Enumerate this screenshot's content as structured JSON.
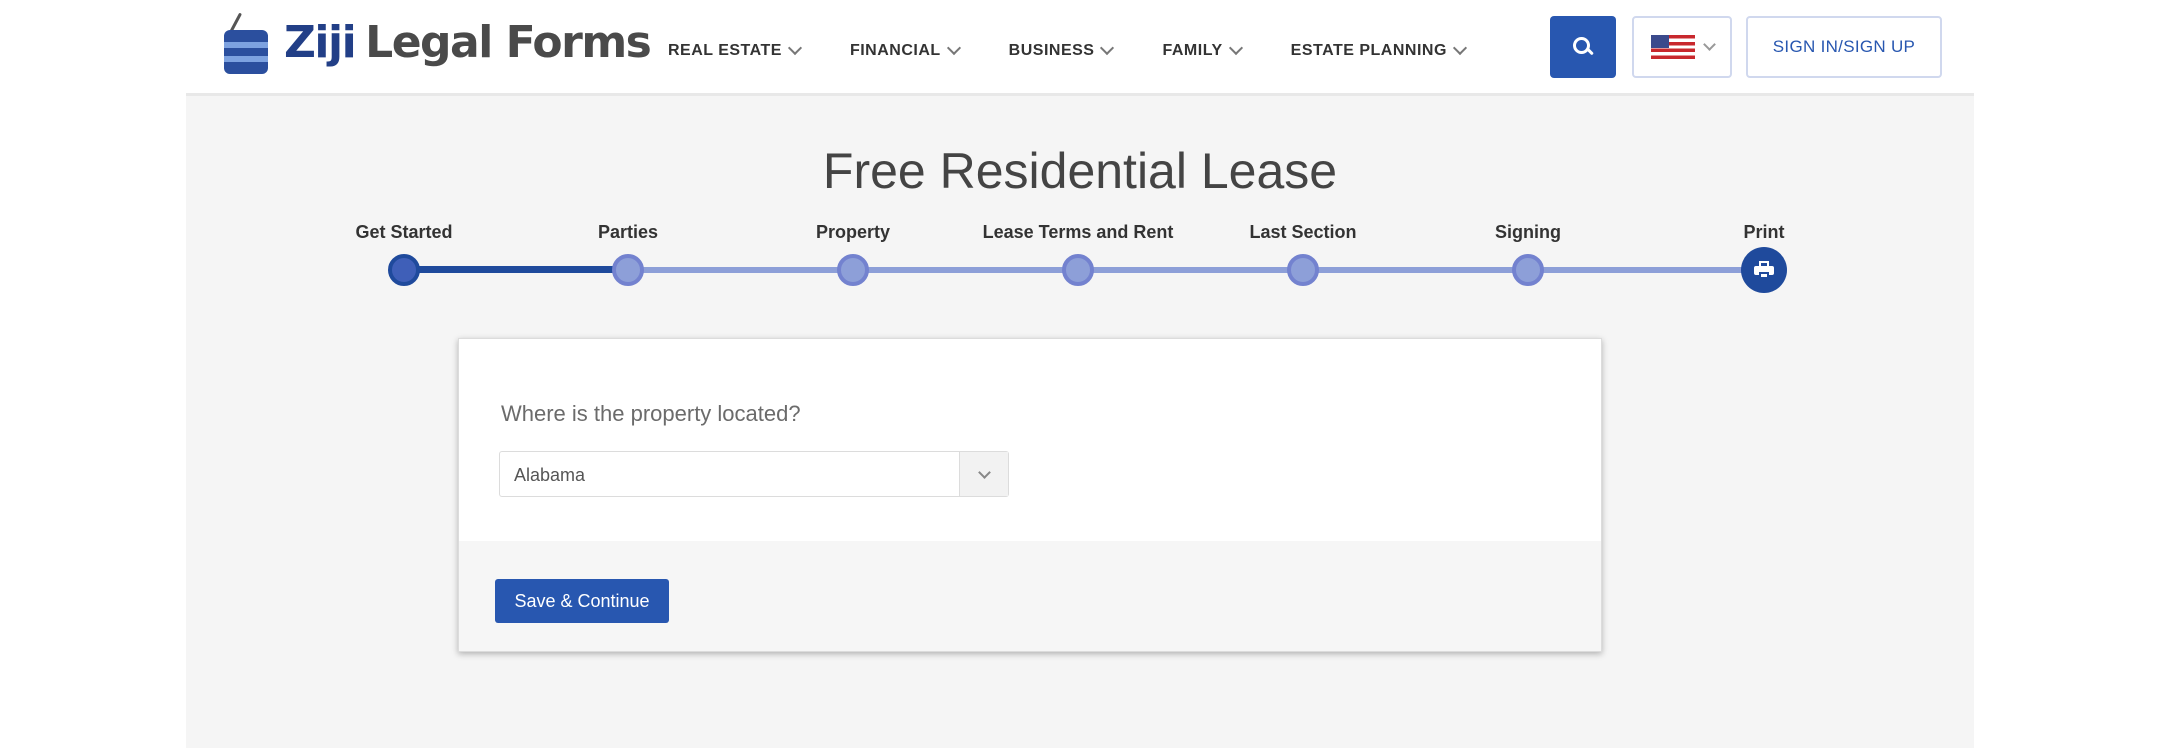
{
  "brand": {
    "name_part1": "Ziji",
    "name_part2": "Legal Forms"
  },
  "nav": [
    {
      "label": "REAL ESTATE"
    },
    {
      "label": "FINANCIAL"
    },
    {
      "label": "BUSINESS"
    },
    {
      "label": "FAMILY"
    },
    {
      "label": "ESTATE PLANNING"
    }
  ],
  "header": {
    "search_icon": "search-icon",
    "language_flag": "us-flag-icon",
    "signin_label": "SIGN IN/SIGN UP"
  },
  "page": {
    "title": "Free Residential Lease"
  },
  "stepper": {
    "current_step": 0,
    "steps": [
      {
        "label": "Get Started"
      },
      {
        "label": "Parties"
      },
      {
        "label": "Property"
      },
      {
        "label": "Lease Terms and Rent"
      },
      {
        "label": "Last Section"
      },
      {
        "label": "Signing"
      },
      {
        "label": "Print",
        "icon": "print-icon"
      }
    ]
  },
  "form": {
    "question": "Where is the property located?",
    "state_select": {
      "value": "Alabama"
    },
    "save_label": "Save & Continue"
  },
  "colors": {
    "brand_blue": "#2857b0",
    "dark_blue": "#1f4a9c",
    "step_light": "#8d9fd8",
    "page_bg": "#f5f5f5"
  }
}
